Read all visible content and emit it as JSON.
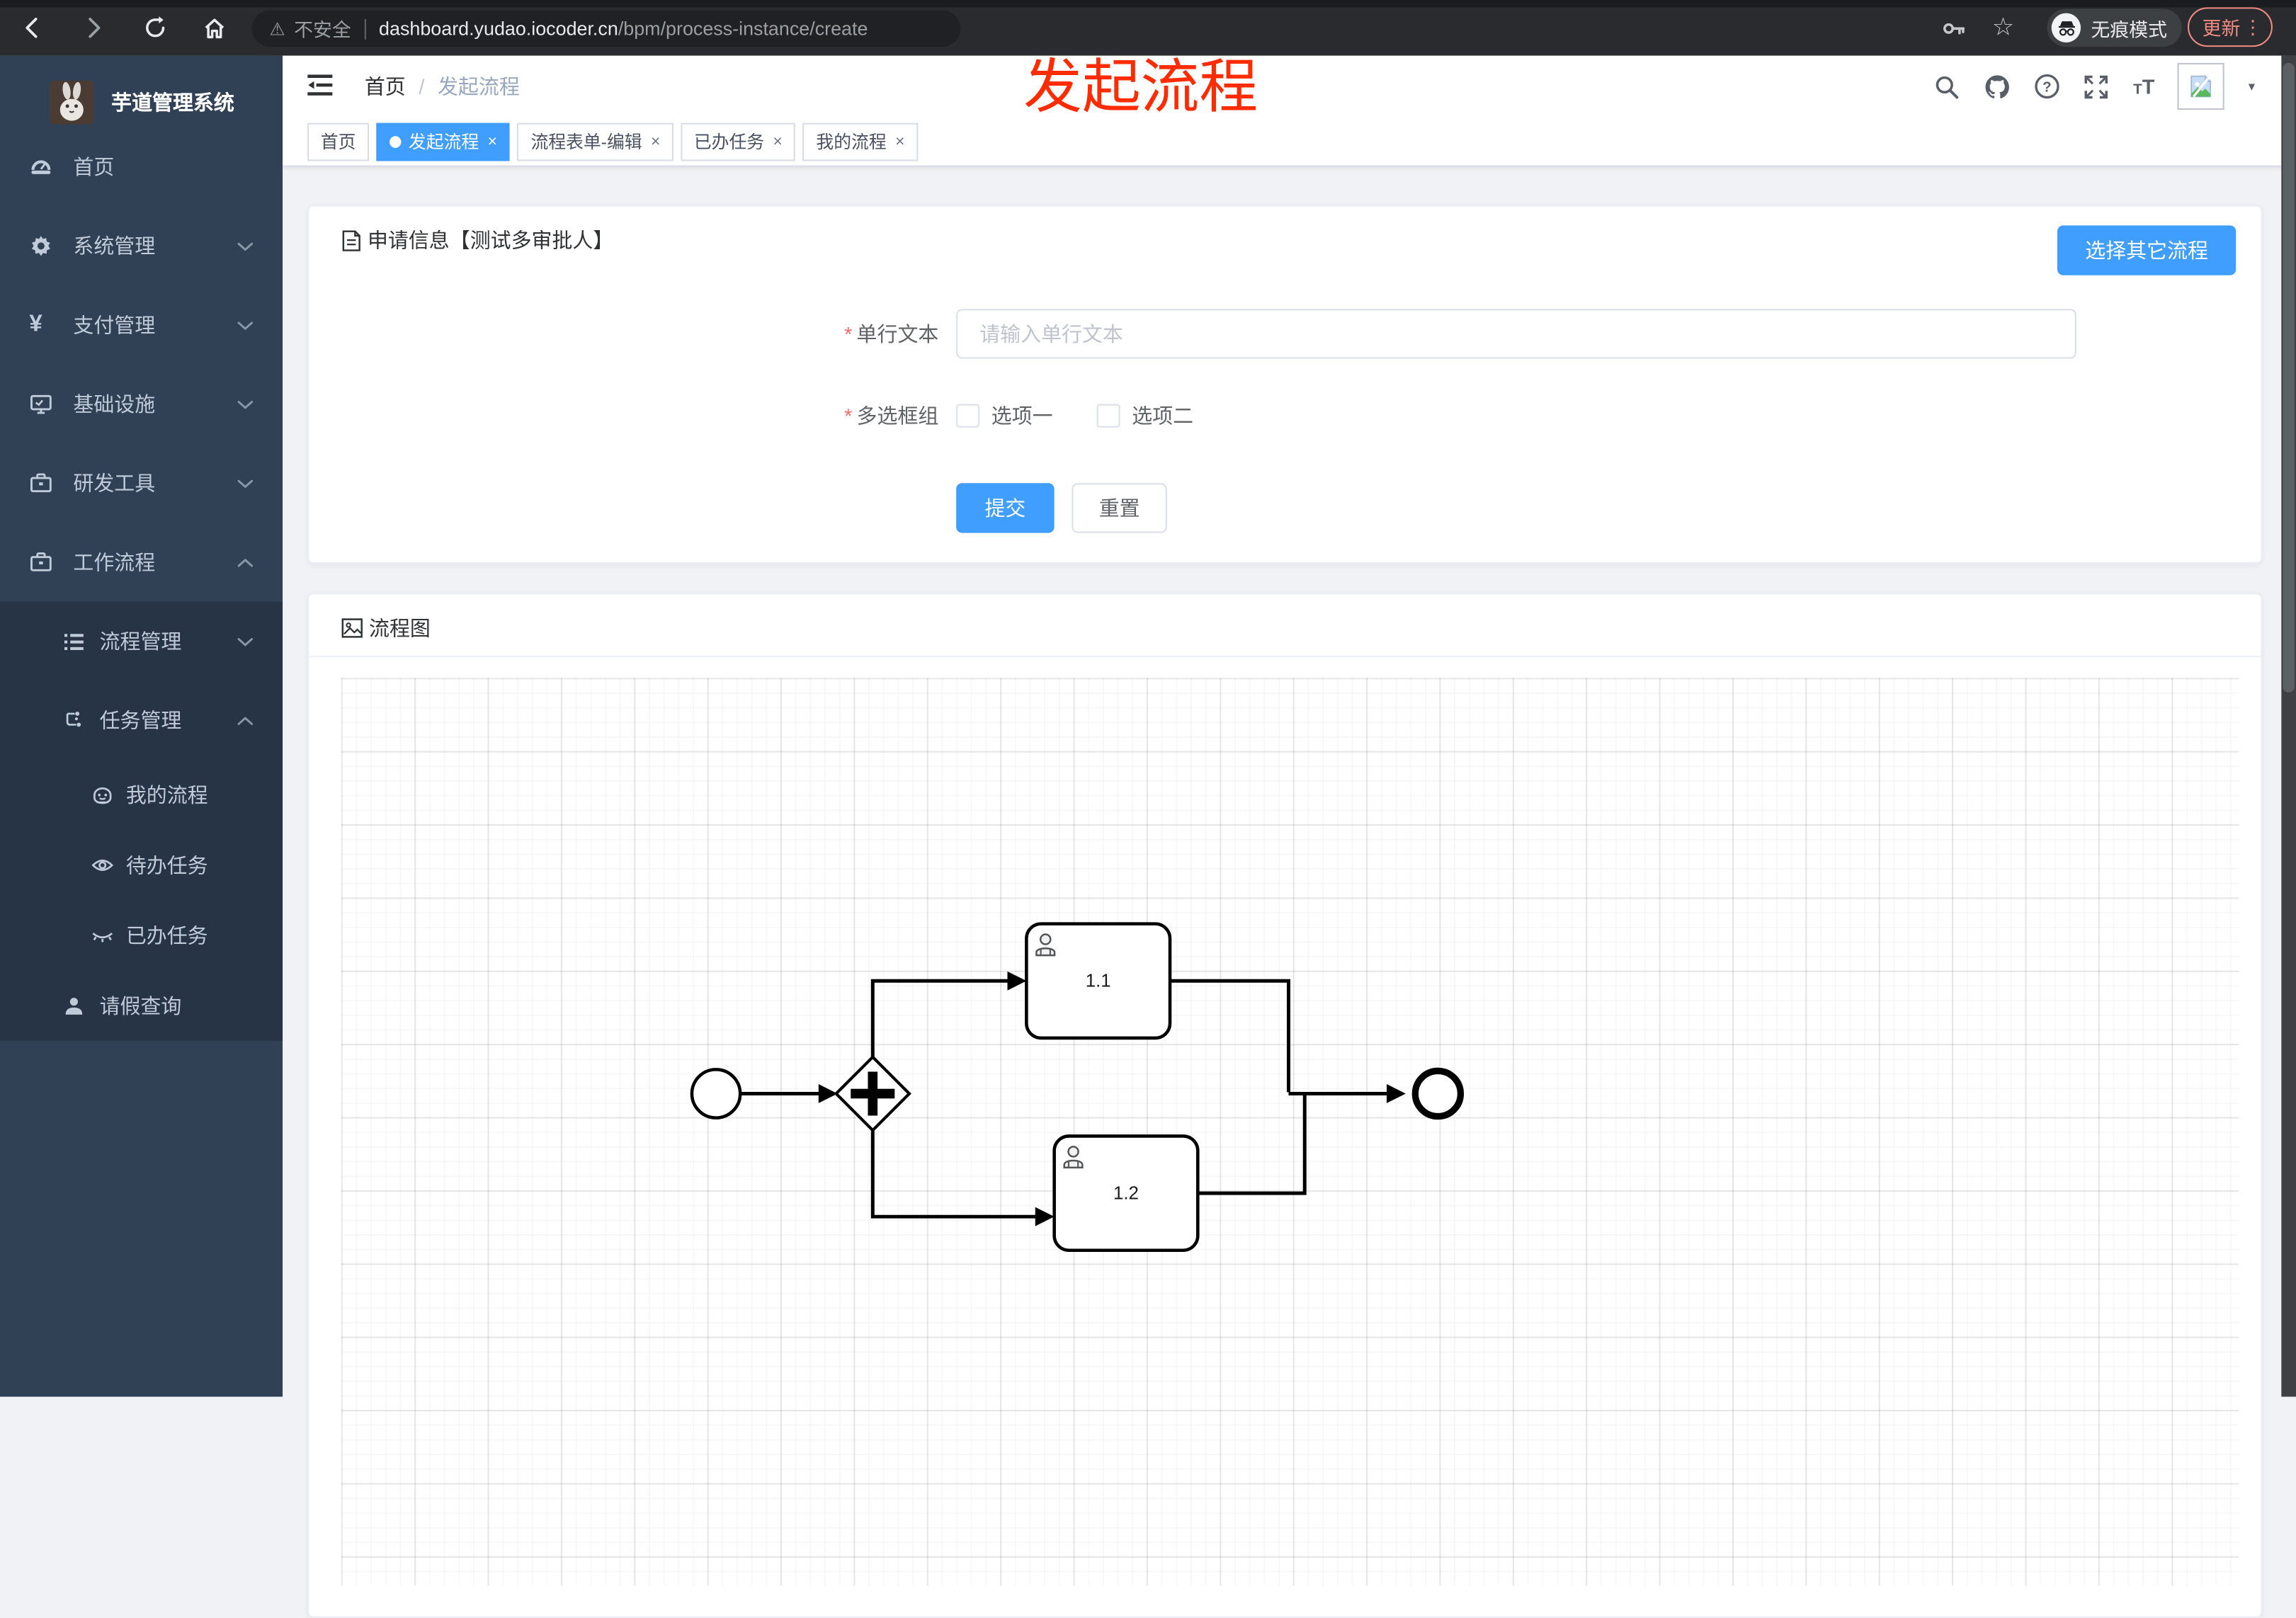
{
  "colors": {
    "primary": "#409EFF",
    "sidebar_bg": "#304156",
    "submenu_bg": "#263445",
    "overlay_red": "#FE2C00",
    "required_red": "#F56C6C",
    "update_pill": "#F28B82"
  },
  "browser": {
    "security_label": "不安全",
    "url_domain": "dashboard.yudao.iocoder.cn",
    "url_path": "/bpm/process-instance/create",
    "incognito_label": "无痕模式",
    "update_label": "更新"
  },
  "ui": {
    "close_glyph": "×",
    "breadcrumb_separator": "/",
    "caret_glyph": "▾",
    "dots_glyph": "⋮",
    "star_glyph": "☆",
    "warning_glyph": "⚠",
    "yen_glyph": "¥"
  },
  "sidebar": {
    "title": "芋道管理系统",
    "items": [
      {
        "label": "首页",
        "icon": "dashboard-icon",
        "level": 1,
        "arrow": "none"
      },
      {
        "label": "系统管理",
        "icon": "gear-icon",
        "level": 1,
        "arrow": "down"
      },
      {
        "label": "支付管理",
        "icon": "yen-icon",
        "level": 1,
        "arrow": "down"
      },
      {
        "label": "基础设施",
        "icon": "monitor-icon",
        "level": 1,
        "arrow": "down"
      },
      {
        "label": "研发工具",
        "icon": "toolbox-icon",
        "level": 1,
        "arrow": "down"
      },
      {
        "label": "工作流程",
        "icon": "toolbox-icon",
        "level": 1,
        "arrow": "up"
      },
      {
        "label": "流程管理",
        "icon": "list-icon",
        "level": 2,
        "arrow": "down"
      },
      {
        "label": "任务管理",
        "icon": "flow-icon",
        "level": 2,
        "arrow": "up"
      },
      {
        "label": "我的流程",
        "icon": "robot-face-icon",
        "level": 3,
        "arrow": "none"
      },
      {
        "label": "待办任务",
        "icon": "eye-open-icon",
        "level": 3,
        "arrow": "none"
      },
      {
        "label": "已办任务",
        "icon": "eye-closed-icon",
        "level": 3,
        "arrow": "none"
      },
      {
        "label": "请假查询",
        "icon": "user-icon",
        "level": 2,
        "arrow": "none"
      }
    ]
  },
  "header": {
    "breadcrumb": [
      "首页",
      "发起流程"
    ],
    "overlay_title": "发起流程"
  },
  "tabs": [
    {
      "label": "首页",
      "active": false,
      "closable": false
    },
    {
      "label": "发起流程",
      "active": true,
      "closable": true
    },
    {
      "label": "流程表单-编辑",
      "active": false,
      "closable": true
    },
    {
      "label": "已办任务",
      "active": false,
      "closable": true
    },
    {
      "label": "我的流程",
      "active": false,
      "closable": true
    }
  ],
  "form_card": {
    "title": "申请信息【测试多审批人】",
    "switch_button": "选择其它流程",
    "fields": [
      {
        "label": "单行文本",
        "required": true,
        "type": "text",
        "value": "",
        "placeholder": "请输入单行文本"
      },
      {
        "label": "多选框组",
        "required": true,
        "type": "checkbox-group",
        "options": [
          {
            "label": "选项一",
            "checked": false
          },
          {
            "label": "选项二",
            "checked": false
          }
        ]
      }
    ],
    "submit_label": "提交",
    "reset_label": "重置"
  },
  "diagram_card": {
    "title": "流程图",
    "type": "bpmn",
    "nodes": [
      {
        "id": "start",
        "type": "start-event"
      },
      {
        "id": "gateway",
        "type": "parallel-gateway"
      },
      {
        "id": "task1",
        "type": "user-task",
        "label": "1.1"
      },
      {
        "id": "task2",
        "type": "user-task",
        "label": "1.2"
      },
      {
        "id": "end",
        "type": "end-event"
      }
    ],
    "flows": [
      "start→gateway",
      "gateway→task1",
      "gateway→task2",
      "task1→end",
      "task2→end"
    ]
  }
}
